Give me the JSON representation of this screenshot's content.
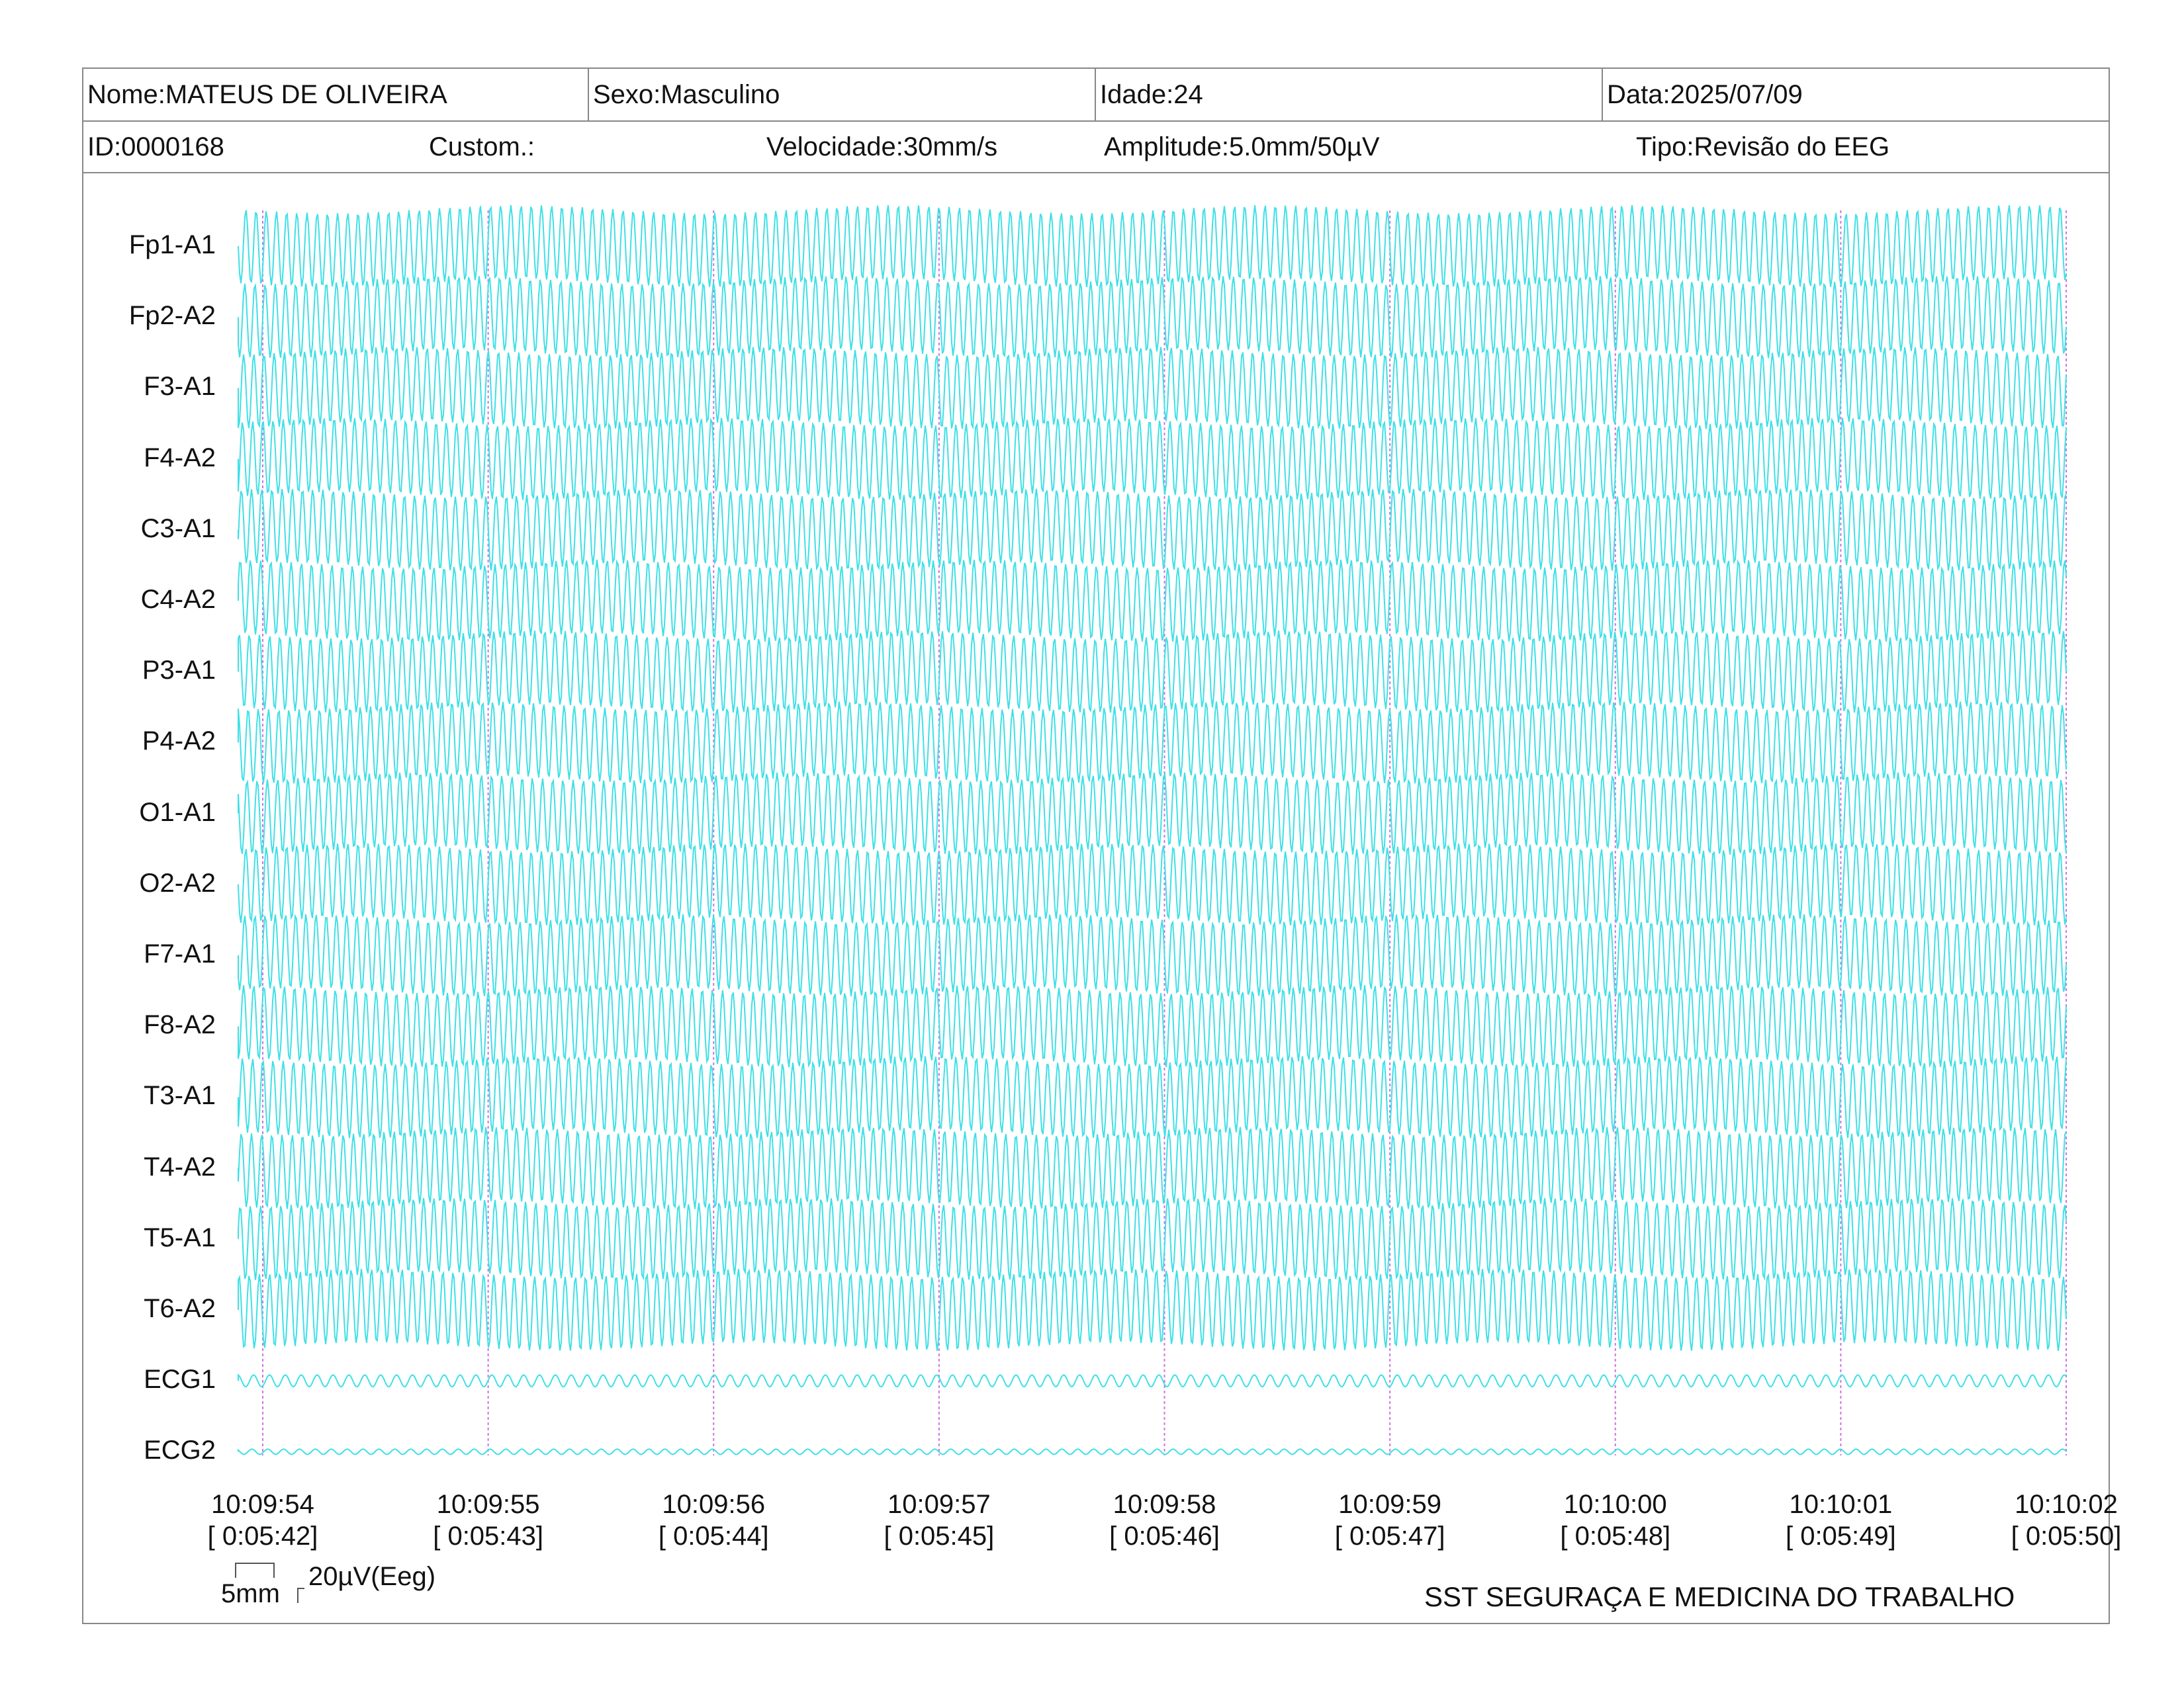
{
  "header": {
    "name": "Nome:MATEUS DE OLIVEIRA",
    "sex": "Sexo:Masculino",
    "age": "Idade:24",
    "date": "Data:2025/07/09",
    "id": "ID:0000168",
    "custom": "Custom.:",
    "speed": "Velocidade:30mm/s",
    "amplitude": "Amplitude:5.0mm/50µV",
    "type": "Tipo:Revisão do EEG"
  },
  "channels": [
    "Fp1-A1",
    "Fp2-A2",
    "F3-A1",
    "F4-A2",
    "C3-A1",
    "C4-A2",
    "P3-A1",
    "P4-A2",
    "O1-A1",
    "O2-A2",
    "F7-A1",
    "F8-A2",
    "T3-A1",
    "T4-A2",
    "T5-A1",
    "T6-A2",
    "ECG1",
    "ECG2"
  ],
  "time_axis": [
    {
      "clock": "10:09:54",
      "elapsed": "[ 0:05:42]"
    },
    {
      "clock": "10:09:55",
      "elapsed": "[ 0:05:43]"
    },
    {
      "clock": "10:09:56",
      "elapsed": "[ 0:05:44]"
    },
    {
      "clock": "10:09:57",
      "elapsed": "[ 0:05:45]"
    },
    {
      "clock": "10:09:58",
      "elapsed": "[ 0:05:46]"
    },
    {
      "clock": "10:09:59",
      "elapsed": "[ 0:05:47]"
    },
    {
      "clock": "10:10:00",
      "elapsed": "[ 0:05:48]"
    },
    {
      "clock": "10:10:01",
      "elapsed": "[ 0:05:49]"
    },
    {
      "clock": "10:10:02",
      "elapsed": "[ 0:05:50]"
    }
  ],
  "scale": {
    "time": "5mm",
    "amp": "20µV(Eeg)"
  },
  "footer": "SST SEGURAÇA E MEDICINA DO TRABALHO",
  "colors": {
    "trace": "#3fe0e6",
    "marker": "#d070e0",
    "border": "#888888"
  }
}
